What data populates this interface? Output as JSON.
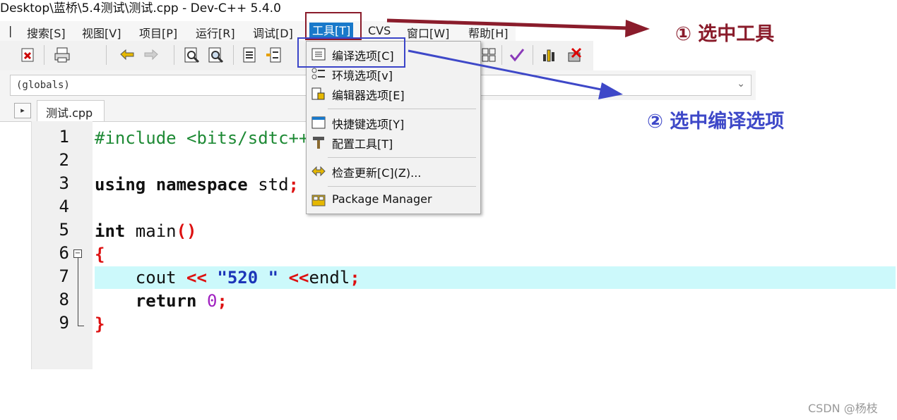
{
  "window": {
    "title": "Desktop\\蓝桥\\5.4测试\\测试.cpp - Dev-C++ 5.4.0"
  },
  "menubar": {
    "items": [
      {
        "label": "搜索[S]"
      },
      {
        "label": "视图[V]"
      },
      {
        "label": "项目[P]"
      },
      {
        "label": "运行[R]"
      },
      {
        "label": "调试[D]"
      },
      {
        "label": "工具[T]",
        "active": true
      },
      {
        "label": "CVS"
      },
      {
        "label": "窗口[W]"
      },
      {
        "label": "帮助[H]"
      }
    ]
  },
  "toolbar": {
    "icons": [
      "close-file-icon",
      "print-icon",
      "undo-icon",
      "redo-icon",
      "find-icon",
      "replace-icon",
      "indent-icon",
      "unindent-icon",
      "grid-icon",
      "check-icon",
      "chart-icon",
      "delete-icon"
    ]
  },
  "scope_combo": {
    "value": "(globals)"
  },
  "tabs": [
    {
      "label": "测试.cpp"
    }
  ],
  "editor": {
    "line_numbers": [
      "1",
      "2",
      "3",
      "4",
      "5",
      "6",
      "7",
      "8",
      "9"
    ],
    "highlighted_line": 7
  },
  "tools_menu": {
    "items": [
      {
        "label": "编译选项[C]",
        "icon": "compiler-options-icon"
      },
      {
        "label": "环境选项[v]",
        "icon": "environment-options-icon"
      },
      {
        "label": "编辑器选项[E]",
        "icon": "editor-options-icon"
      },
      {
        "label": "快捷键选项[Y]",
        "icon": "shortcut-options-icon"
      },
      {
        "label": "配置工具[T]",
        "icon": "hammer-icon"
      },
      {
        "label": "检查更新[C](Z)...",
        "icon": "update-icon"
      },
      {
        "label": "Package Manager",
        "icon": "package-icon"
      }
    ]
  },
  "annotations": {
    "step1": "① 选中工具",
    "step2": "② 选中编译选项",
    "step1_color": "#8a1c2b",
    "step2_color": "#3e48c8"
  },
  "watermark": "CSDN @杨枝"
}
